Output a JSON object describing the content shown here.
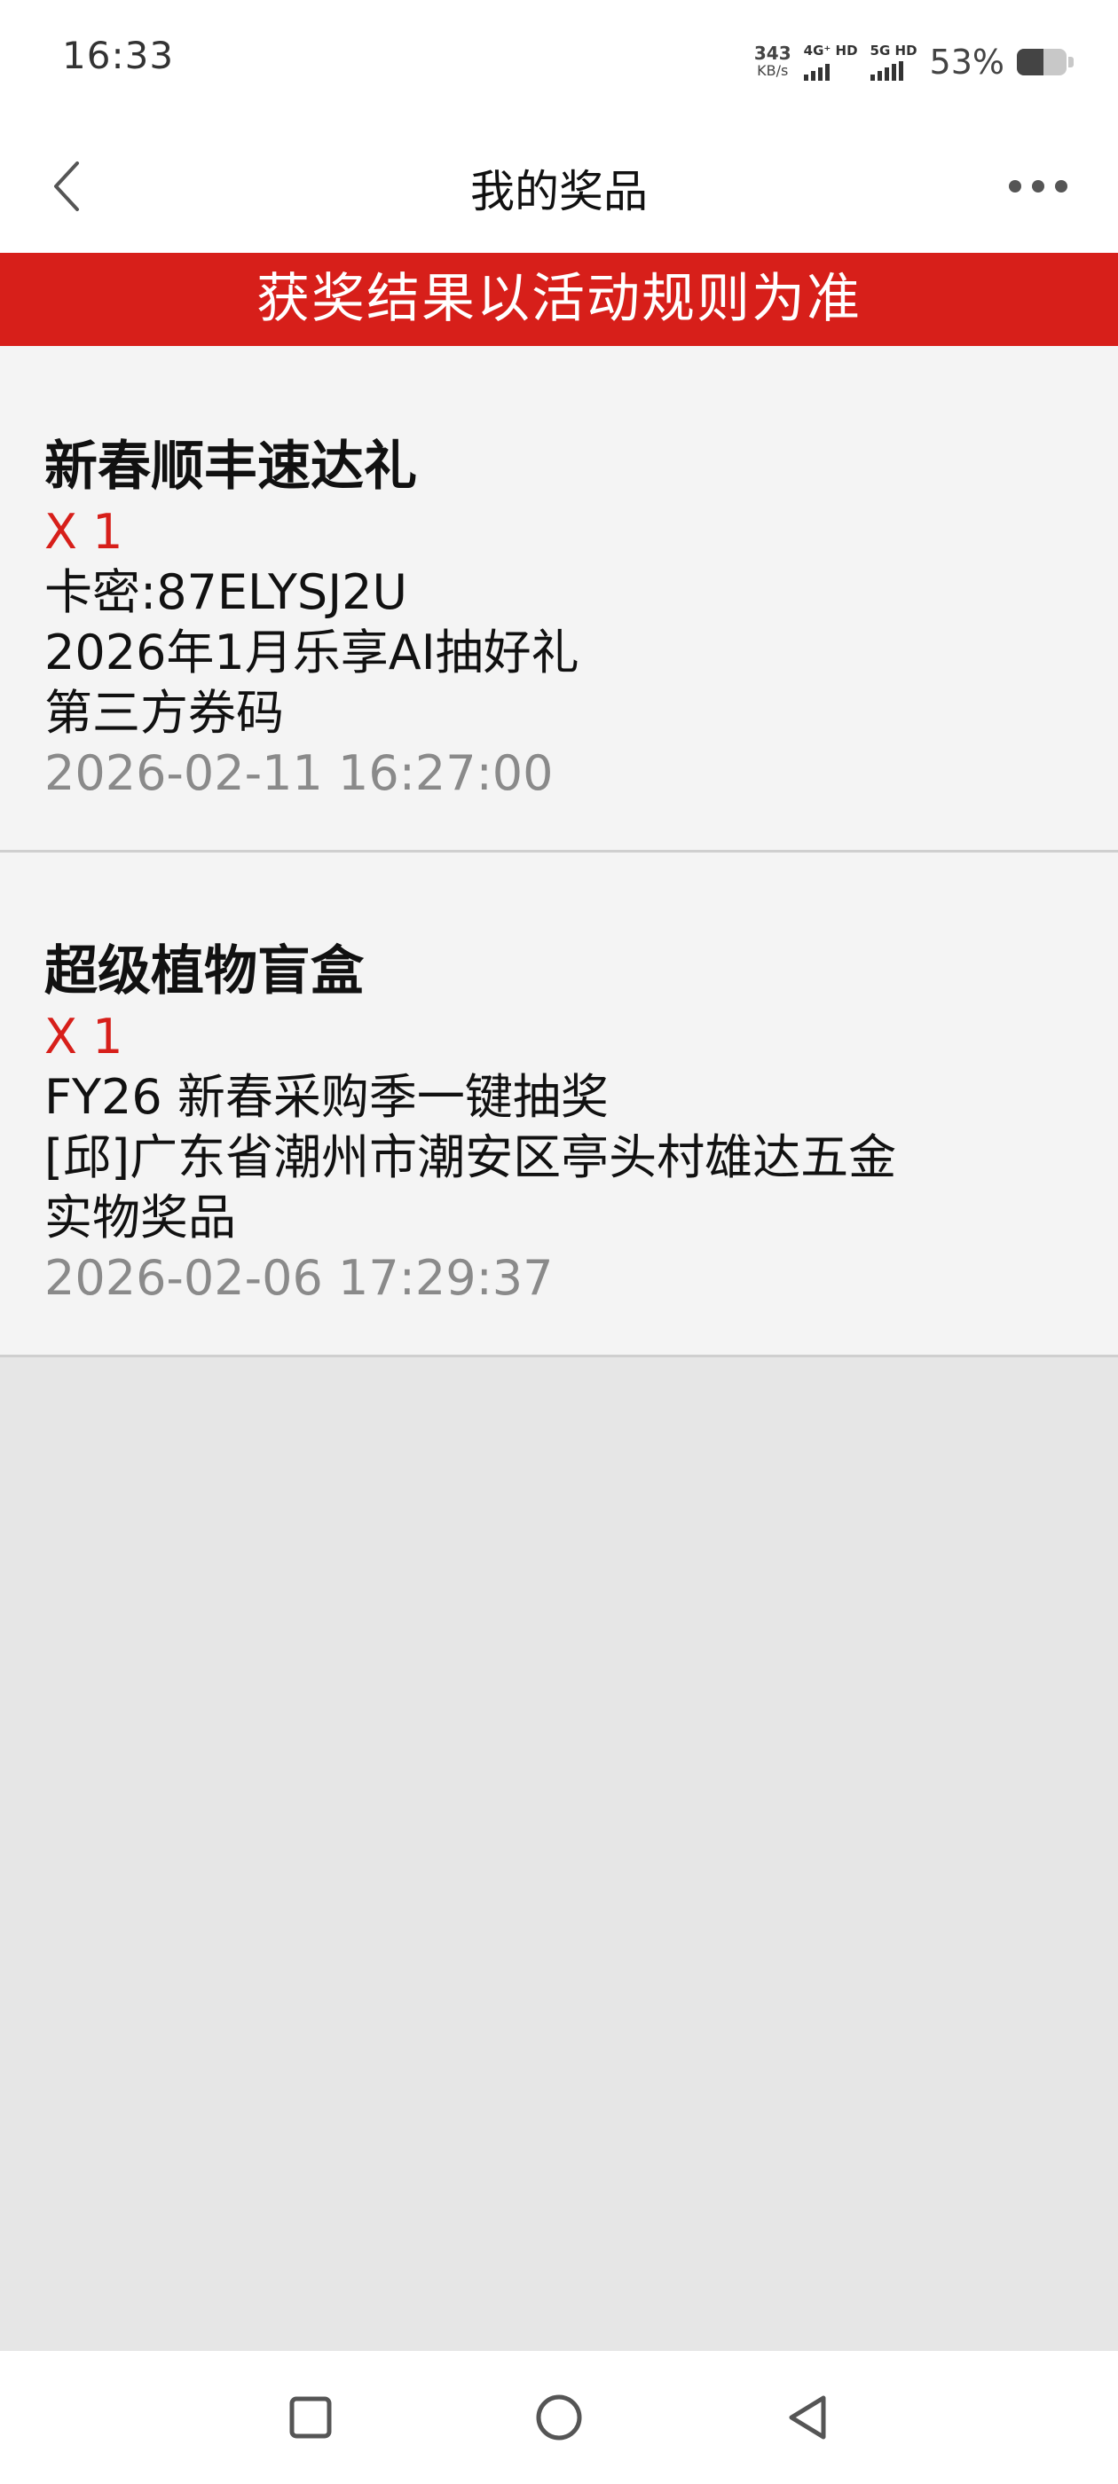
{
  "status_bar": {
    "time": "16:33",
    "net_speed_value": "343",
    "net_speed_unit": "KB/s",
    "sim1_label": "4G⁺ HD",
    "sim2_label": "5G HD",
    "battery_percent": "53%",
    "battery_level": 0.53
  },
  "nav": {
    "title": "我的奖品",
    "back_icon": "chevron-left-icon",
    "more_icon": "more-horizontal-icon"
  },
  "banner": {
    "text": "获奖结果以活动规则为准",
    "color": "#d71f1a"
  },
  "prizes": [
    {
      "title": "新春顺丰速达礼",
      "quantity": "X 1",
      "lines": [
        "卡密:87ELYSJ2U",
        "2026年1月乐享AI抽好礼",
        "第三方券码"
      ],
      "time": "2026-02-11 16:27:00"
    },
    {
      "title": "超级植物盲盒",
      "quantity": "X 1",
      "lines": [
        "FY26 新春采购季一键抽奖",
        "[邱]广东省潮州市潮安区亭头村雄达五金",
        "实物奖品"
      ],
      "time": "2026-02-06 17:29:37"
    }
  ],
  "system_nav": {
    "recent_icon": "square-icon",
    "home_icon": "circle-icon",
    "back_icon": "triangle-back-icon"
  }
}
